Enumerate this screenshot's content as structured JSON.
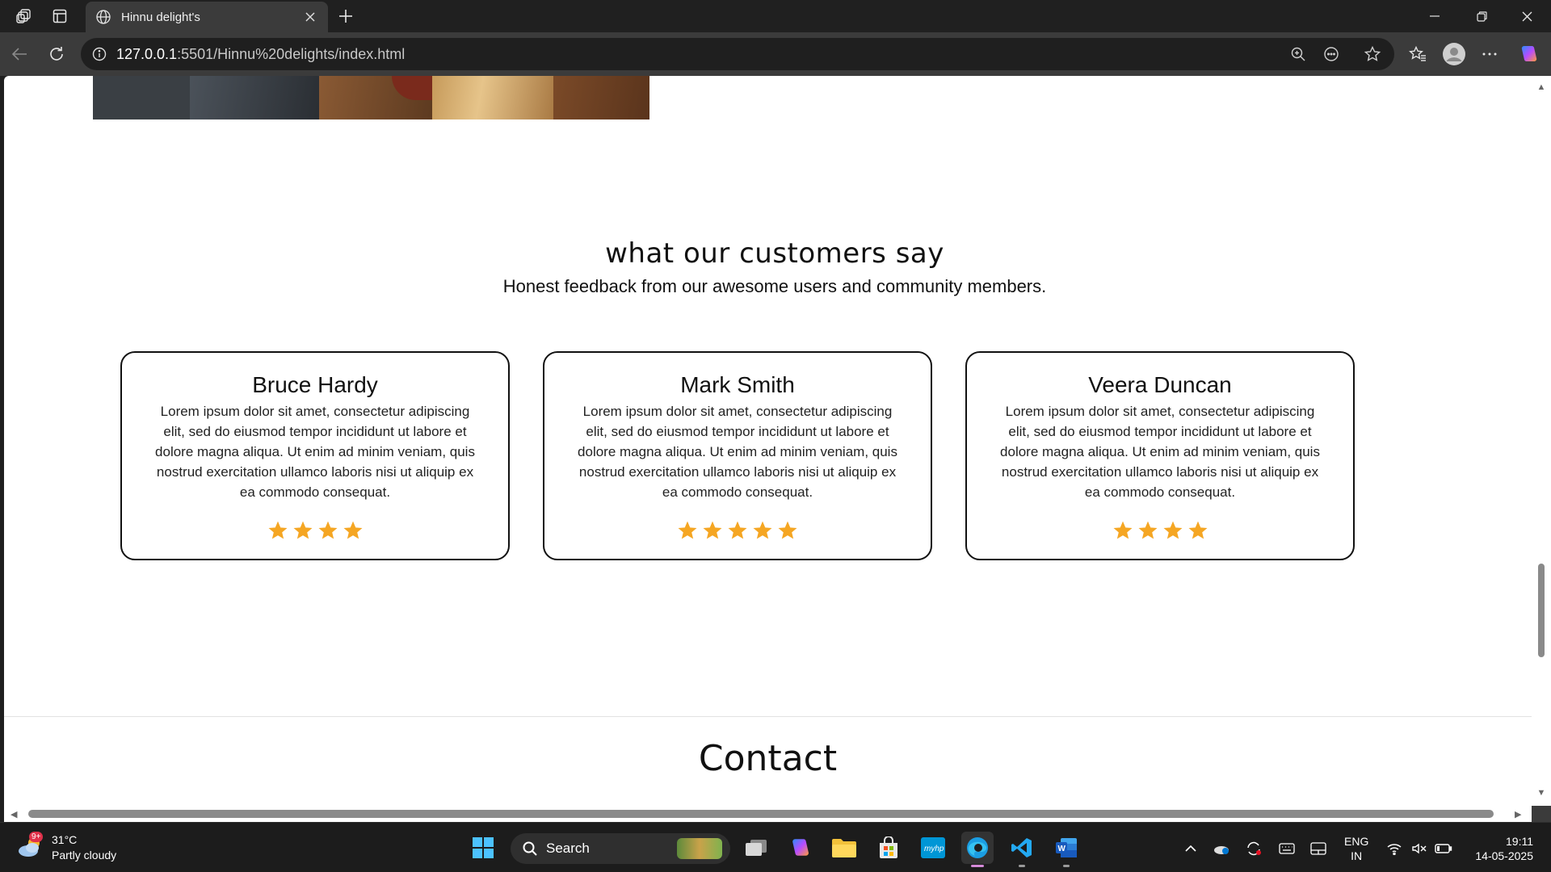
{
  "browser": {
    "tab_title": "Hinnu delight's",
    "url_host": "127.0.0.1",
    "url_rest": ":5501/Hinnu%20delights/index.html"
  },
  "page": {
    "testimonials": {
      "title": "what our customers say",
      "subtitle": "Honest feedback from our awesome users and community members.",
      "cards": [
        {
          "name": "Bruce Hardy",
          "text": "Lorem ipsum dolor sit amet, consectetur adipiscing elit, sed do eiusmod tempor incididunt ut labore et dolore magna aliqua. Ut enim ad minim veniam, quis nostrud exercitation ullamco laboris nisi ut aliquip ex ea commodo consequat.",
          "rating": 4
        },
        {
          "name": "Mark Smith",
          "text": "Lorem ipsum dolor sit amet, consectetur adipiscing elit, sed do eiusmod tempor incididunt ut labore et dolore magna aliqua. Ut enim ad minim veniam, quis nostrud exercitation ullamco laboris nisi ut aliquip ex ea commodo consequat.",
          "rating": 5
        },
        {
          "name": "Veera Duncan",
          "text": "Lorem ipsum dolor sit amet, consectetur adipiscing elit, sed do eiusmod tempor incididunt ut labore et dolore magna aliqua. Ut enim ad minim veniam, quis nostrud exercitation ullamco laboris nisi ut aliquip ex ea commodo consequat.",
          "rating": 4
        }
      ],
      "star_color": "#f5a623"
    },
    "contact_title": "Contact"
  },
  "taskbar": {
    "weather_badge": "9+",
    "temperature": "31°C",
    "weather_desc": "Partly cloudy",
    "search_label": "Search",
    "lang_line1": "ENG",
    "lang_line2": "IN",
    "time": "19:11",
    "date": "14-05-2025"
  }
}
